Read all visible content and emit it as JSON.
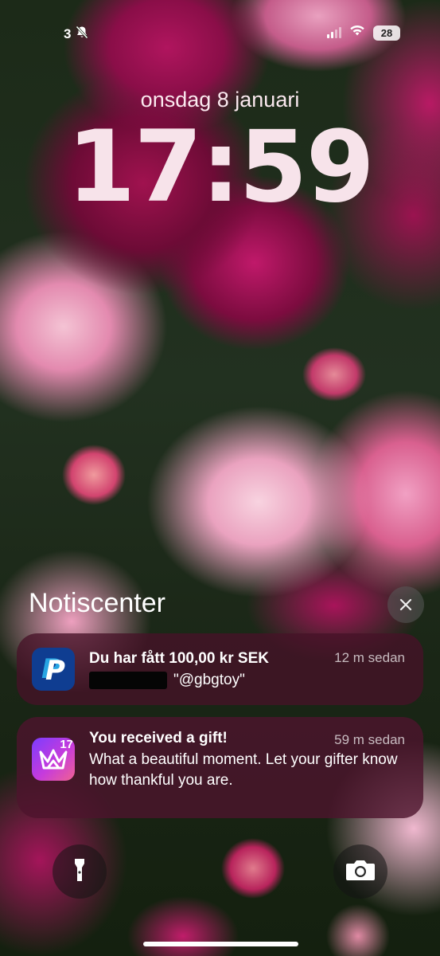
{
  "status_bar": {
    "notification_count": "3",
    "silent_icon": "bell-slash-icon",
    "signal_icon": "cellular-signal-icon",
    "wifi_icon": "wifi-icon",
    "battery_level": "28"
  },
  "lock_screen": {
    "date": "onsdag 8 januari",
    "time": "17:59"
  },
  "notification_center": {
    "title": "Notiscenter",
    "close_icon": "close-icon",
    "notifications": [
      {
        "app_icon": "paypal-icon",
        "title": "Du har fått 100,00 kr SEK",
        "time": "12 m sedan",
        "body": "\"@gbgtoy\""
      },
      {
        "app_icon": "gift-app-icon",
        "badge": "17",
        "title": "You received a gift!",
        "time": "59 m sedan",
        "body": "What a beautiful moment. Let your gifter know how thankful you are."
      }
    ]
  },
  "quick_actions": {
    "left_icon": "flashlight-icon",
    "right_icon": "camera-icon"
  }
}
